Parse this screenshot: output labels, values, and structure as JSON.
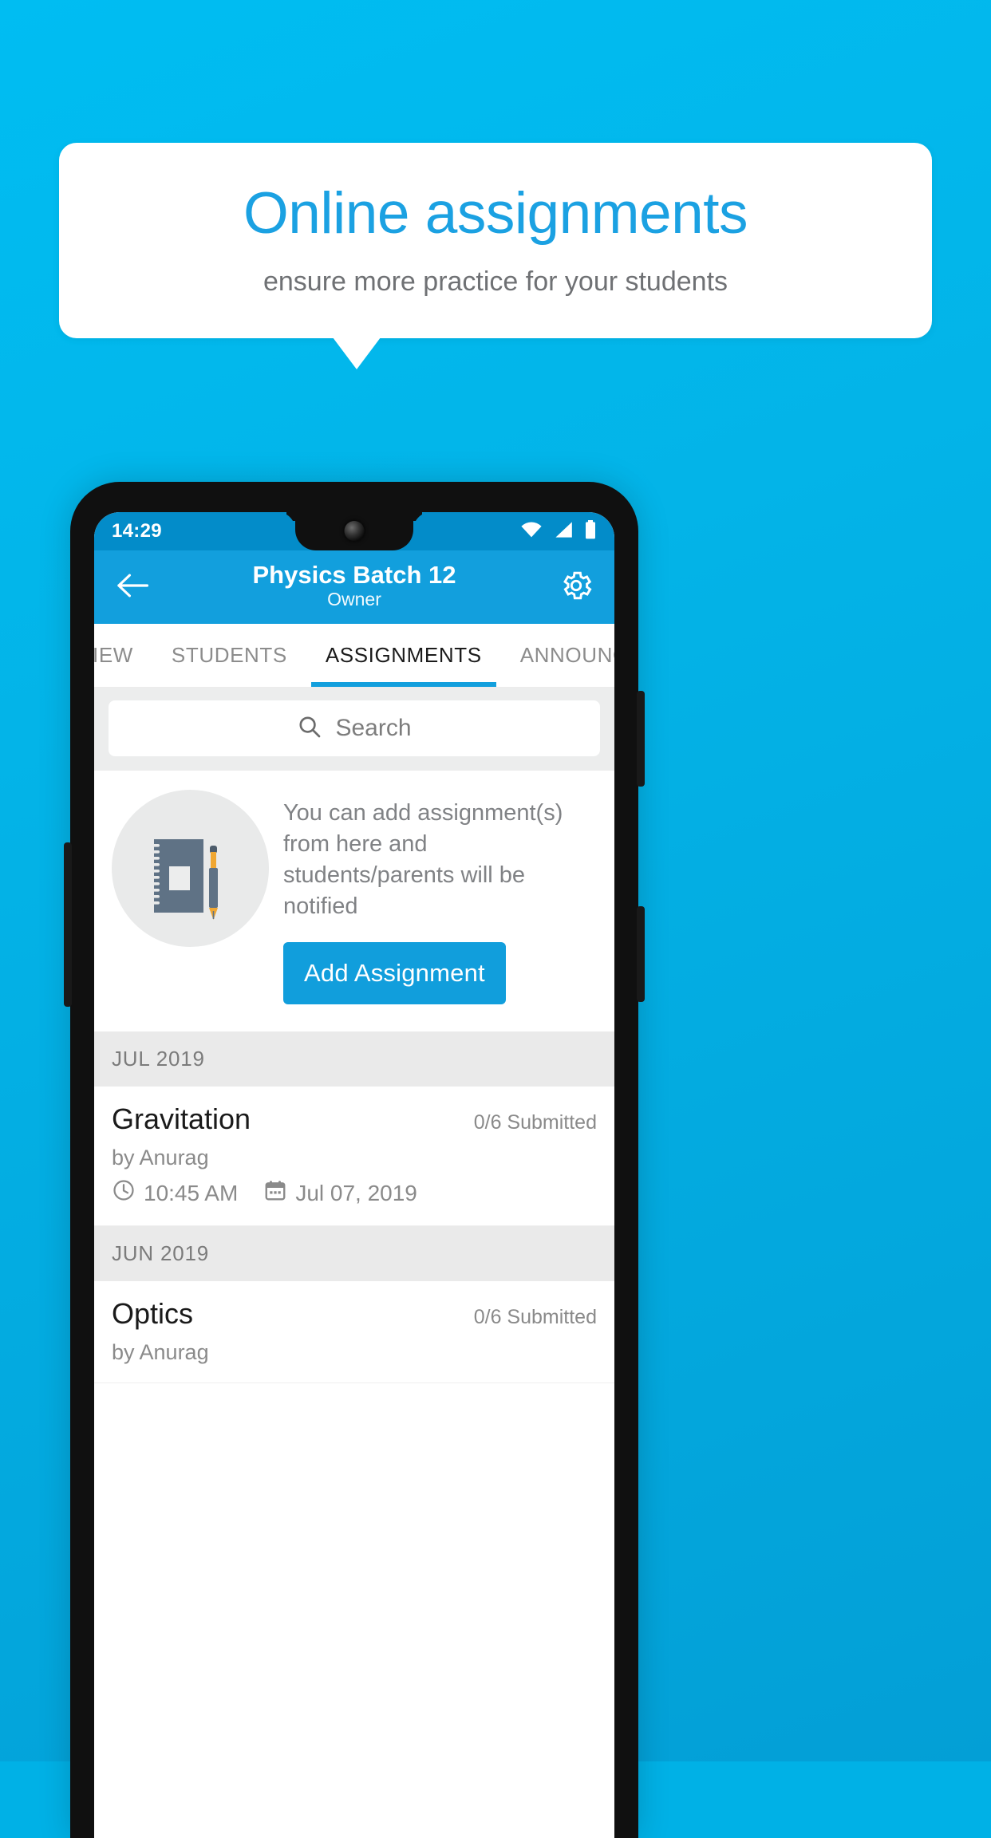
{
  "promo": {
    "title": "Online assignments",
    "subtitle": "ensure more practice for your students",
    "accent_color": "#1ba1e2",
    "background_color": "#00b1e6"
  },
  "phone": {
    "statusbar": {
      "time": "14:29",
      "icons": [
        "wifi-icon",
        "cellular-signal-icon",
        "battery-icon"
      ]
    },
    "appbar": {
      "back_icon": "back-arrow-icon",
      "title": "Physics Batch 12",
      "subtitle": "Owner",
      "settings_icon": "gear-icon",
      "color": "#129fdd"
    },
    "tabs": [
      {
        "label": "IEW",
        "active": false
      },
      {
        "label": "STUDENTS",
        "active": false
      },
      {
        "label": "ASSIGNMENTS",
        "active": true
      },
      {
        "label": "ANNOUNCEM",
        "active": false
      }
    ],
    "search": {
      "placeholder": "Search",
      "value": "",
      "icon": "search-icon"
    },
    "empty_state": {
      "illustration": "notebook-and-pen-icon",
      "text": "You can add assignment(s) from here and students/parents will be notified",
      "button_label": "Add Assignment",
      "button_color": "#119edc"
    },
    "sections": [
      {
        "month": "JUL 2019",
        "items": [
          {
            "title": "Gravitation",
            "submitted": "0/6 Submitted",
            "by": "by Anurag",
            "time": "10:45 AM",
            "date": "Jul 07, 2019",
            "clock_icon": "clock-icon",
            "calendar_icon": "calendar-icon"
          }
        ]
      },
      {
        "month": "JUN 2019",
        "items": [
          {
            "title": "Optics",
            "submitted": "0/6 Submitted",
            "by": "by Anurag",
            "time": "",
            "date": "",
            "clock_icon": "clock-icon",
            "calendar_icon": "calendar-icon"
          }
        ]
      }
    ]
  }
}
